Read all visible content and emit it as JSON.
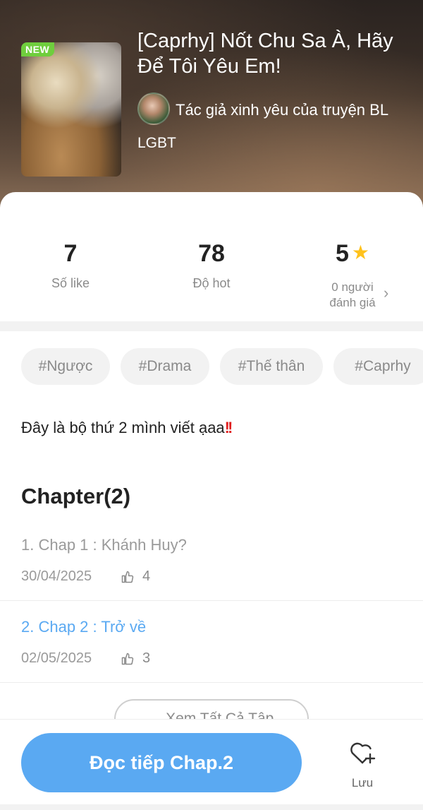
{
  "story": {
    "badge": "NEW",
    "title": "[Caprhy] Nốt Chu Sa À, Hãy Để Tôi Yêu Em!",
    "author": "Tác giả xinh yêu của truyện BL",
    "genre": "LGBT"
  },
  "stats": {
    "likes": {
      "value": "7",
      "label": "Số like"
    },
    "hot": {
      "value": "78",
      "label": "Độ hot"
    },
    "rating": {
      "value": "5",
      "count_line1": "0 người",
      "count_line2": "đánh giá",
      "star_color": "#ffc21c"
    }
  },
  "tags": [
    "#Ngược",
    "#Drama",
    "#Thế thân",
    "#Caprhy"
  ],
  "description": "Đây là bộ thứ 2 mình viết ạaa",
  "description_emoji": "!!",
  "chapters": {
    "heading": "Chapter(2)",
    "items": [
      {
        "title": "1. Chap 1 : Khánh Huy?",
        "date": "30/04/2025",
        "likes": "4",
        "color": "#9a9a9a"
      },
      {
        "title": "2. Chap 2 : Trở về",
        "date": "02/05/2025",
        "likes": "3",
        "color": "#5aa9f2"
      }
    ],
    "view_all": "Xem Tất Cả Tập"
  },
  "actions": {
    "read_button": "Đọc tiếp Chap.2",
    "save_label": "Lưu",
    "accent": "#5aa9f2"
  }
}
